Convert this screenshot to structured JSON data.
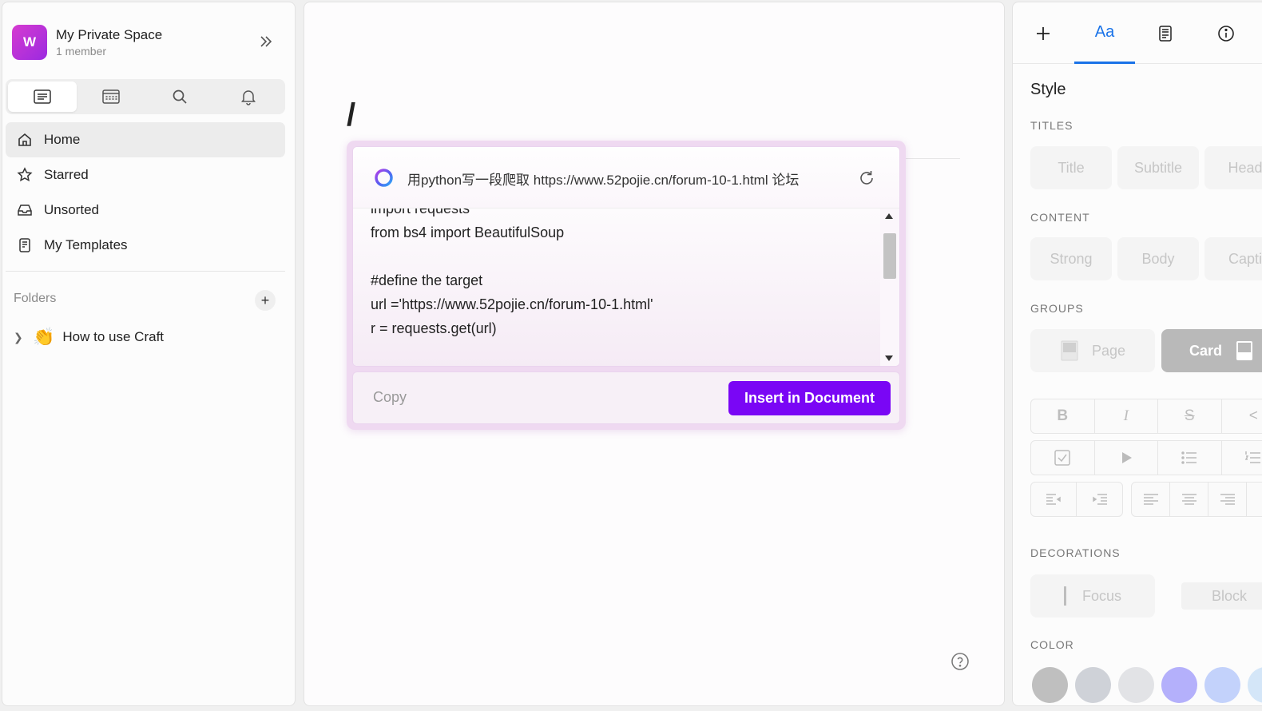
{
  "sidebar": {
    "space_initial": "W",
    "space_name": "My Private Space",
    "space_members": "1 member",
    "nav": [
      {
        "label": "Home"
      },
      {
        "label": "Starred"
      },
      {
        "label": "Unsorted"
      },
      {
        "label": "My Templates"
      }
    ],
    "folders_title": "Folders",
    "folder_items": [
      {
        "label": "How to use Craft",
        "emoji": "👏"
      }
    ]
  },
  "editor": {
    "slash": "/",
    "ai": {
      "prompt": "用python写一段爬取 https://www.52pojie.cn/forum-10-1.html 论坛",
      "code_lines": [
        "import requests",
        "from bs4 import BeautifulSoup",
        "",
        "#define the target",
        "url ='https://www.52pojie.cn/forum-10-1.html'",
        "r = requests.get(url)"
      ],
      "copy_label": "Copy",
      "insert_label": "Insert in Document"
    }
  },
  "inspector": {
    "tabs": {
      "aa": "Aa"
    },
    "style_title": "Style",
    "titles_label": "TITLES",
    "titles": [
      "Title",
      "Subtitle",
      "Head"
    ],
    "content_label": "CONTENT",
    "content": [
      "Strong",
      "Body",
      "Capti"
    ],
    "groups_label": "GROUPS",
    "groups": [
      "Page",
      "Card"
    ],
    "format_row1": [
      "B",
      "I",
      "S",
      "<"
    ],
    "decorations_label": "DECORATIONS",
    "decorations": [
      "Focus",
      "Block"
    ],
    "color_label": "COLOR",
    "colors": [
      "#bfbfbf",
      "#cfd2d8",
      "#e2e3e6",
      "#b4b0fb",
      "#c3d2fb",
      "#d4e6f8"
    ]
  }
}
